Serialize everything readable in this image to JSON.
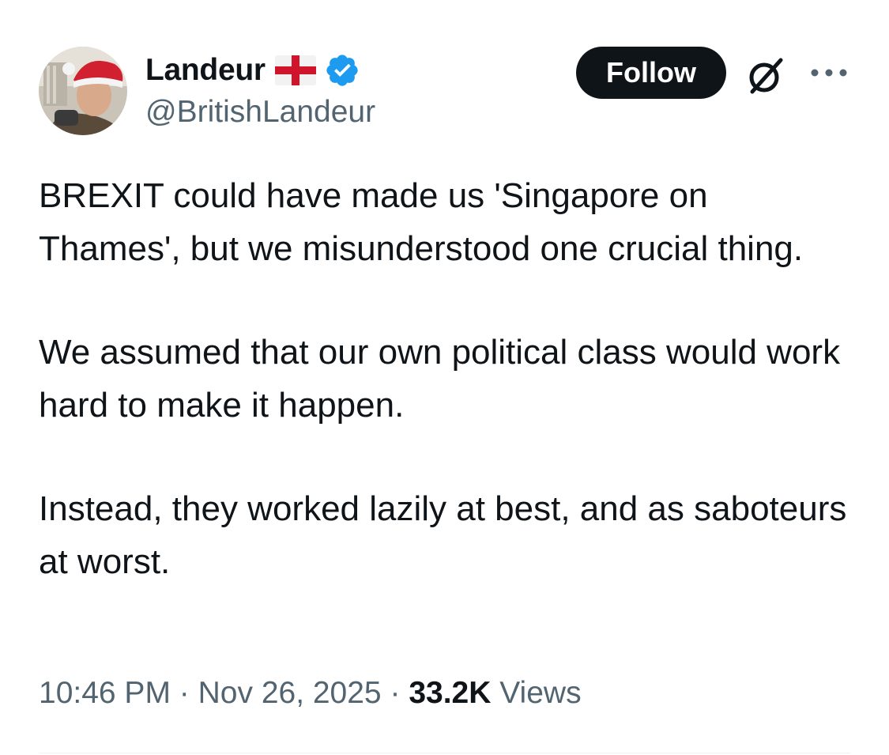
{
  "author": {
    "display_name": "Landeur",
    "handle": "@BritishLandeur",
    "flag_icon": "england-flag-icon",
    "verified_icon": "verified-badge-icon",
    "verified_color": "#1d9bf0"
  },
  "actions": {
    "follow_label": "Follow",
    "grok_icon": "grok-icon",
    "more_icon": "more-options-icon"
  },
  "tweet": {
    "paragraphs": [
      "BREXIT could have made us 'Singapore on Thames', but we misunderstood one crucial thing.",
      "We assumed that our own political class would work hard to make it happen.",
      "Instead, they worked lazily at best, and as saboteurs at worst."
    ]
  },
  "meta": {
    "time": "10:46 PM",
    "separator": "·",
    "date": "Nov 26, 2025",
    "views_count": "33.2K",
    "views_label": "Views"
  },
  "colors": {
    "text_primary": "#0f1419",
    "text_secondary": "#536471",
    "button_bg": "#0f1419",
    "flag_red": "#cf142b"
  }
}
